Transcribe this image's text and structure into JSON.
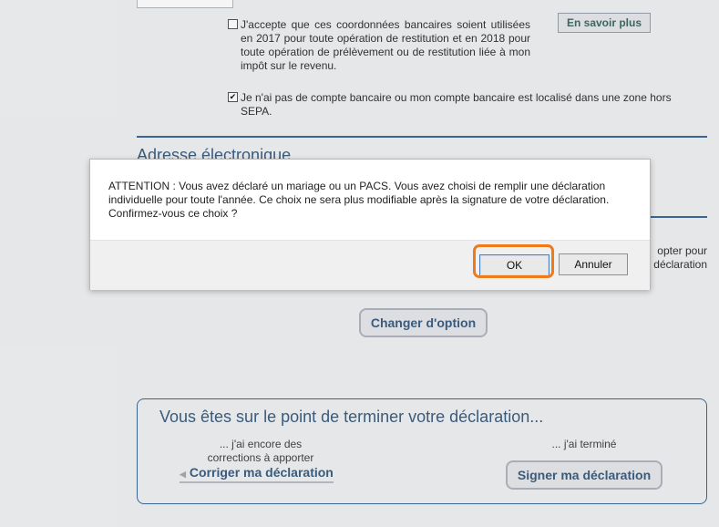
{
  "form": {
    "bank_consent_text": "J'accepte que ces coordonnées bancaires soient utilisées en 2017 pour toute opération de restitution et en 2018 pour toute opération de prélèvement ou de restitution liée à mon impôt sur le revenu.",
    "bank_consent_checked": false,
    "learn_more_label": "En savoir plus",
    "no_account_text": "Je n'ai pas de compte bancaire ou mon compte bancaire est localisé dans une zone hors SEPA.",
    "no_account_checked": true,
    "email_section_title": "Adresse électronique",
    "right_fragment_line1": "opter pour",
    "right_fragment_line2": "déclaration",
    "change_option_label": "Changer d'option"
  },
  "finish": {
    "title": "Vous êtes sur le point de terminer votre déclaration...",
    "corrections_hint_line1": "... j'ai encore des",
    "corrections_hint_line2": "corrections à apporter",
    "correct_label": "Corriger ma déclaration",
    "done_hint": "... j'ai terminé",
    "sign_label": "Signer ma déclaration"
  },
  "dialog": {
    "message_line1": "ATTENTION : Vous avez déclaré un mariage ou un PACS. Vous avez choisi de remplir une déclaration",
    "message_line2": "individuelle pour toute l'année. Ce choix ne sera plus modifiable après la signature de votre déclaration.",
    "message_line3": "Confirmez-vous ce choix ?",
    "ok_label": "OK",
    "cancel_label": "Annuler"
  },
  "colors": {
    "accent": "#3d6a98",
    "highlight": "#ef7a1a"
  }
}
